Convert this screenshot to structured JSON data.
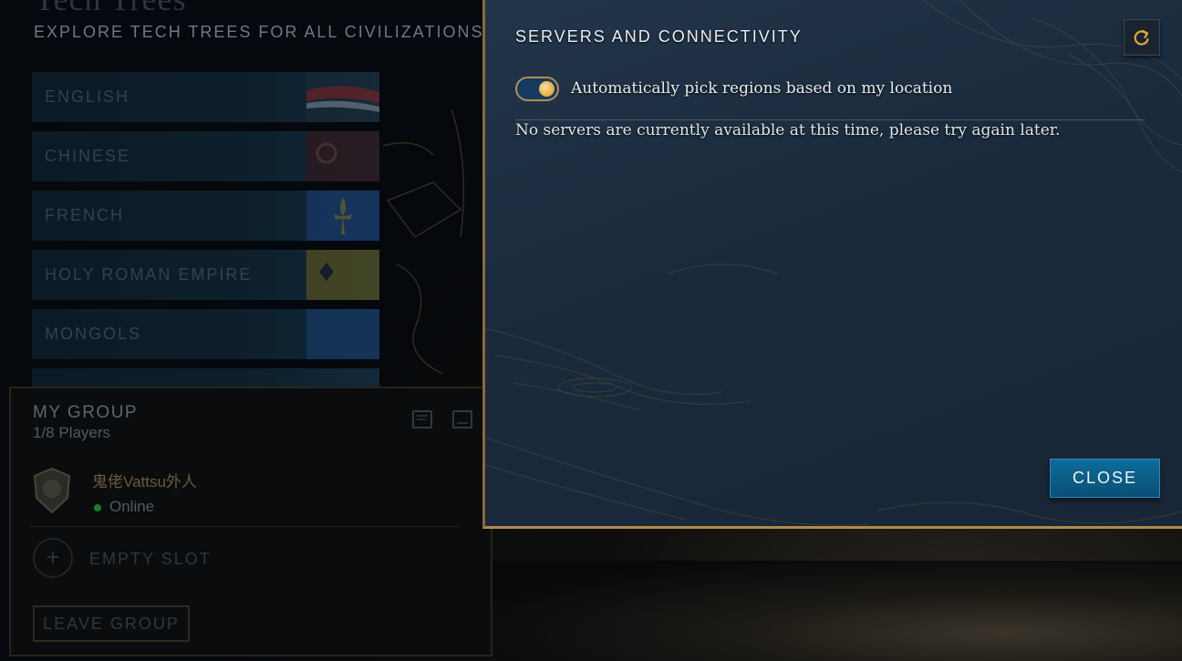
{
  "background": {
    "title": "Tech Trees",
    "subtitle": "EXPLORE TECH TREES FOR ALL CIVILIZATIONS",
    "civilizations": [
      {
        "label": "ENGLISH",
        "flag_color": "#8a2020"
      },
      {
        "label": "CHINESE",
        "flag_color": "#6a1616"
      },
      {
        "label": "FRENCH",
        "flag_color": "#1a3f7a"
      },
      {
        "label": "HOLY ROMAN EMPIRE",
        "flag_color": "#8a7a20"
      },
      {
        "label": "MONGOLS",
        "flag_color": "#1a4a8a"
      }
    ]
  },
  "group": {
    "title": "MY GROUP",
    "count": "1/8 Players",
    "member": {
      "name": "鬼佬Vattsu外人",
      "status": "Online"
    },
    "empty_slot": "EMPTY SLOT",
    "leave_button": "LEAVE GROUP"
  },
  "modal": {
    "title": "SERVERS AND CONNECTIVITY",
    "toggle_label": "Automatically pick regions based on my location",
    "toggle_on": true,
    "message": "No servers are currently available at this time, please try again later.",
    "close_button": "CLOSE",
    "refresh_icon": "refresh-icon"
  },
  "colors": {
    "modal_bg": "#1e3045",
    "accent_gold": "#b08a4e",
    "close_button": "#0a5a85",
    "online": "#1e7a2a"
  }
}
